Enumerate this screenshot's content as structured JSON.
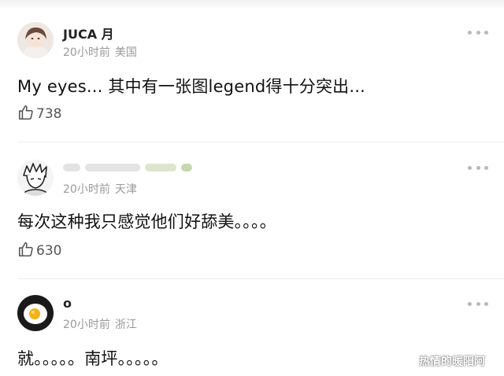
{
  "comments": [
    {
      "username": "JUCA 月",
      "time": "20小时前",
      "location": "美国",
      "text": "My eyes... 其中有一张图legend得十分突出...",
      "likes": "738"
    },
    {
      "username": "",
      "time": "20小时前",
      "location": "天津",
      "text": "每次这种我只感觉他们好舔美。。。。",
      "likes": "630"
    },
    {
      "username": "o",
      "time": "20小时前",
      "location": "浙江",
      "text": "就。。。。。南坪。。。。。",
      "likes": ""
    }
  ],
  "watermark": "热情的暖阳阿",
  "icons": {
    "more": "more-dots-icon",
    "like": "thumbs-up-icon"
  },
  "colors": {
    "meta": "#9a9a9a",
    "divider": "#ececec"
  }
}
